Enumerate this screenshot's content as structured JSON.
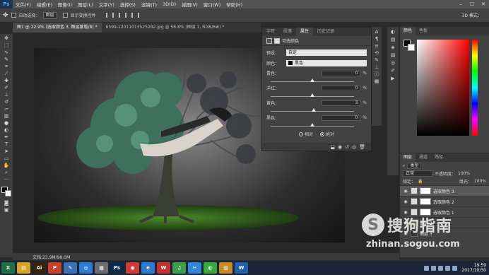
{
  "app": {
    "logo": "Ps"
  },
  "menu": [
    "文件(F)",
    "编辑(E)",
    "图像(I)",
    "图层(L)",
    "文字(Y)",
    "选择(S)",
    "滤镜(T)",
    "3D(D)",
    "视图(V)",
    "窗口(W)",
    "帮助(H)"
  ],
  "window_controls": [
    "–",
    "☐",
    "✕"
  ],
  "options": {
    "auto_select_label": "自动选择：",
    "auto_select_value": "图层",
    "show_transform_label": "显示变换控件",
    "mode_3d_label": "3D 模式："
  },
  "doc_tabs": [
    {
      "label": "图1 @ 22.9% (选取颜色 3, 图层蒙版/8) *",
      "active": true
    },
    {
      "label": "6599-12011013525282.jpg @ 56.8% (图层 1, RGB/8#) *",
      "active": false
    }
  ],
  "statusbar": {
    "text": "文档:23.9M/98.0M"
  },
  "properties": {
    "tabs": [
      {
        "label": "字符",
        "active": false
      },
      {
        "label": "段落",
        "active": false
      },
      {
        "label": "属性",
        "active": true
      },
      {
        "label": "历史记录",
        "active": false
      }
    ],
    "header": "可选颜色",
    "preset_label": "预设：",
    "preset_value": "自定",
    "colors_label": "颜色：",
    "colors_value": "黑色",
    "sliders": [
      {
        "label": "青色：",
        "value": "0",
        "unit": "%",
        "position": 0.5
      },
      {
        "label": "洋红：",
        "value": "0",
        "unit": "%",
        "position": 0.5
      },
      {
        "label": "黄色：",
        "value": "3",
        "unit": "%",
        "position": 0.515
      },
      {
        "label": "黑色：",
        "value": "0",
        "unit": "%",
        "position": 0.5
      }
    ],
    "relative_label": "相对",
    "absolute_label": "绝对",
    "method_selected": "absolute"
  },
  "color_panel": {
    "tabs": [
      {
        "label": "颜色",
        "active": true
      },
      {
        "label": "色板",
        "active": false
      }
    ],
    "foreground": "#000000",
    "background": "#ffffff"
  },
  "layers": {
    "tabs": [
      {
        "label": "图层",
        "active": true
      },
      {
        "label": "通道",
        "active": false
      },
      {
        "label": "路径",
        "active": false
      }
    ],
    "filter_label": "类型",
    "blend_mode": "正常",
    "opacity_label": "不透明度：",
    "opacity_value": "100%",
    "lock_label": "锁定：",
    "fill_label": "填充：",
    "fill_value": "100%",
    "items": [
      {
        "name": "选取颜色 3",
        "selected": true
      },
      {
        "name": "选取颜色 2",
        "selected": false
      },
      {
        "name": "选取颜色 1",
        "selected": false
      },
      {
        "name": "图层 2",
        "selected": false
      },
      {
        "name": "图层 3",
        "selected": false
      }
    ]
  },
  "watermark": {
    "logo": "S",
    "text": "搜狗指南",
    "url": "zhinan.sogou.com"
  },
  "taskbar": {
    "apps": [
      {
        "name": "excel",
        "label": "X",
        "color": "#1e7145"
      },
      {
        "name": "explorer",
        "label": "▤",
        "color": "#d9a520"
      },
      {
        "name": "illustrator",
        "label": "Ai",
        "color": "#3a2206"
      },
      {
        "name": "powerpoint",
        "label": "P",
        "color": "#c94320"
      },
      {
        "name": "paint",
        "label": "✎",
        "color": "#3b6fb6"
      },
      {
        "name": "baidu-netdisk",
        "label": "◎",
        "color": "#2a7dd3"
      },
      {
        "name": "media",
        "label": "▦",
        "color": "#6d6d6d"
      },
      {
        "name": "photoshop",
        "label": "Ps",
        "color": "#0e2a4a"
      },
      {
        "name": "chrome",
        "label": "◉",
        "color": "#d23b2f"
      },
      {
        "name": "ie",
        "label": "e",
        "color": "#2b7bd0"
      },
      {
        "name": "wps",
        "label": "W",
        "color": "#c8302a"
      },
      {
        "name": "qq-music",
        "label": "♫",
        "color": "#3aa14b"
      },
      {
        "name": "snipping",
        "label": "✂",
        "color": "#2e87d8"
      },
      {
        "name": "360",
        "label": "◐",
        "color": "#38a93b"
      },
      {
        "name": "wps-folder",
        "label": "▥",
        "color": "#c78b1f"
      },
      {
        "name": "word",
        "label": "W",
        "color": "#1f5fab"
      }
    ],
    "time": "19:59",
    "date": "2017/10/30"
  }
}
